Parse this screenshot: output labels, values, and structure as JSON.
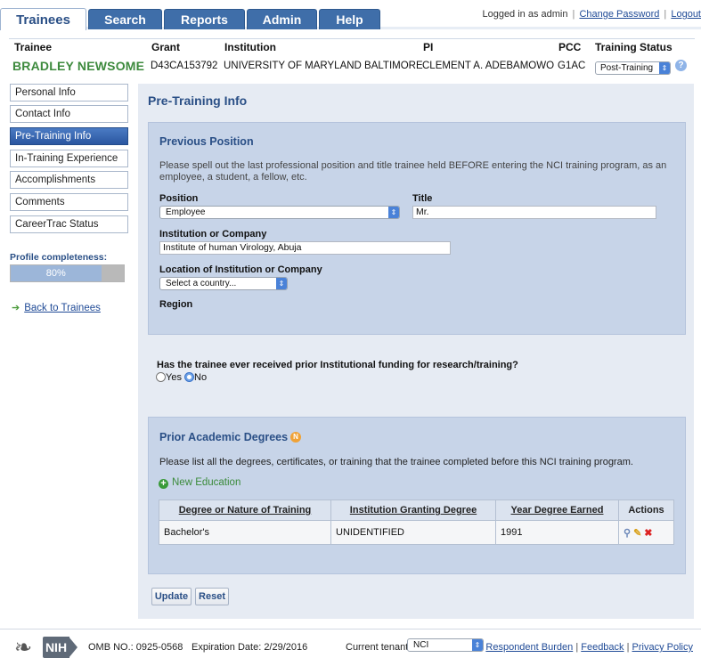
{
  "nav": {
    "tabs": [
      {
        "label": "Trainees",
        "active": true
      },
      {
        "label": "Search",
        "active": false
      },
      {
        "label": "Reports",
        "active": false
      },
      {
        "label": "Admin",
        "active": false
      },
      {
        "label": "Help",
        "active": false
      }
    ],
    "logged_in_text": "Logged in as admin",
    "change_password": "Change Password",
    "separator": "|",
    "logout": "Logout"
  },
  "header": {
    "labels": {
      "trainee": "Trainee",
      "grant": "Grant",
      "institution": "Institution",
      "pi": "PI",
      "pcc": "PCC",
      "training_status": "Training Status"
    },
    "values": {
      "trainee": "BRADLEY NEWSOME",
      "grant": "D43CA153792",
      "institution": "UNIVERSITY OF MARYLAND BALTIMORE",
      "pi": "CLEMENT A. ADEBAMOWO",
      "pcc": "G1AC",
      "training_status": "Post-Training"
    },
    "help_glyph": "?"
  },
  "sidebar": {
    "items": [
      {
        "label": "Personal Info",
        "active": false
      },
      {
        "label": "Contact Info",
        "active": false
      },
      {
        "label": "Pre-Training Info",
        "active": true
      },
      {
        "label": "In-Training Experience",
        "active": false
      },
      {
        "label": "Accomplishments",
        "active": false
      },
      {
        "label": "Comments",
        "active": false
      },
      {
        "label": "CareerTrac Status",
        "active": false
      }
    ],
    "completeness_label": "Profile completeness:",
    "completeness_percent": 80,
    "completeness_text": "80%",
    "back_link": "Back to Trainees"
  },
  "main": {
    "page_title": "Pre-Training Info",
    "previous_position": {
      "title": "Previous Position",
      "instructions_line1": "Please spell out the last professional position and title trainee held BEFORE entering the NCI training program, as an",
      "instructions_line2": "employee, a student, a fellow, etc.",
      "position_label": "Position",
      "position_value": "Employee",
      "title_label": "Title",
      "title_value": "Mr.",
      "institution_label": "Institution or Company",
      "institution_value": "Institute of human Virology, Abuja",
      "location_label": "Location of Institution or Company",
      "location_value": "Select a country...",
      "region_label": "Region"
    },
    "funding": {
      "question": "Has the trainee ever received prior Institutional funding for research/training?",
      "yes_label": "Yes",
      "no_label": "No",
      "selected": "No"
    },
    "degrees": {
      "title": "Prior Academic Degrees",
      "badge": "N",
      "instructions": "Please list all the degrees, certificates, or training that the trainee completed before this NCI training program.",
      "new_education": "New Education",
      "columns": [
        "Degree or Nature of Training",
        "Institution Granting Degree",
        "Year Degree Earned",
        "Actions"
      ],
      "rows": [
        {
          "degree": "Bachelor's",
          "institution": "UNIDENTIFIED",
          "year": "1991"
        }
      ]
    },
    "buttons": {
      "update": "Update",
      "reset": "Reset"
    }
  },
  "footer": {
    "nih": "NIH",
    "omb": "OMB NO.: 0925-0568",
    "expiration": "Expiration Date: 2/29/2016",
    "tenant_label": "Current tenant:",
    "tenant_value": "NCI",
    "links": [
      "Respondent Burden",
      "Feedback",
      "Privacy Policy"
    ],
    "separator": "|"
  },
  "colors": {
    "accent": "#3f6ea9",
    "trainee_name": "#3d8a3d",
    "panel": "#c7d4e8"
  }
}
